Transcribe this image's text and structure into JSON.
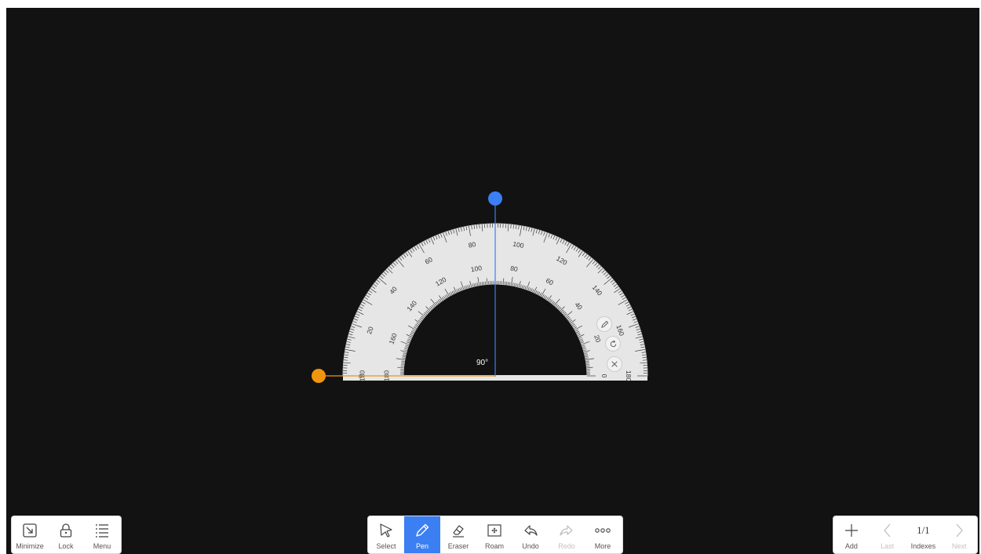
{
  "protractor": {
    "angle_readout": "90°",
    "outer_scale_labels": [
      "180",
      "20",
      "40",
      "60",
      "80",
      "100",
      "120",
      "140",
      "160",
      "180"
    ],
    "inner_scale_labels": [
      "180",
      "160",
      "140",
      "120",
      "100",
      "80",
      "60",
      "40",
      "20",
      "0"
    ],
    "bottom_scale_left_label": "0",
    "accent_color": "#3b7ff2",
    "handle_color": "#f0960e",
    "tools": [
      "pencil-icon",
      "rotate-icon",
      "close-icon"
    ]
  },
  "left_toolbar": {
    "items": [
      {
        "label": "Minimize",
        "icon": "minimize-icon"
      },
      {
        "label": "Lock",
        "icon": "lock-icon"
      },
      {
        "label": "Menu",
        "icon": "menu-icon"
      }
    ]
  },
  "center_toolbar": {
    "items": [
      {
        "label": "Select",
        "icon": "select-arrow-icon"
      },
      {
        "label": "Pen",
        "icon": "pen-icon",
        "active": true
      },
      {
        "label": "Eraser",
        "icon": "eraser-icon"
      },
      {
        "label": "Roam",
        "icon": "roam-icon"
      },
      {
        "label": "Undo",
        "icon": "undo-icon"
      },
      {
        "label": "Redo",
        "icon": "redo-icon",
        "disabled": true
      },
      {
        "label": "More",
        "icon": "more-icon"
      }
    ]
  },
  "right_toolbar": {
    "items": [
      {
        "label": "Add",
        "icon": "plus-icon"
      },
      {
        "label": "Last",
        "icon": "chevron-left-icon",
        "disabled": true
      },
      {
        "label": "Indexes",
        "page": "1/1"
      },
      {
        "label": "Next",
        "icon": "chevron-right-icon",
        "disabled": true
      }
    ]
  }
}
